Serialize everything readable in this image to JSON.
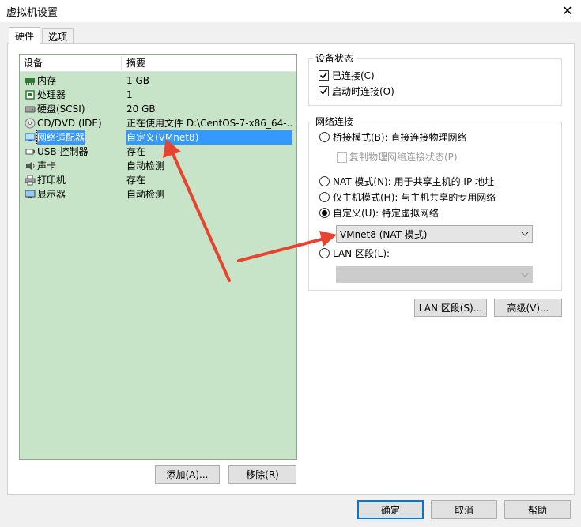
{
  "window": {
    "title": "虚拟机设置",
    "close_glyph": "✕"
  },
  "tabs": [
    {
      "label": "硬件",
      "active": true
    },
    {
      "label": "选项",
      "active": false
    }
  ],
  "hardware_list": {
    "columns": {
      "device": "设备",
      "summary": "摘要"
    },
    "rows": [
      {
        "icon": "memory-icon",
        "name": "内存",
        "summary": "1 GB"
      },
      {
        "icon": "processor-icon",
        "name": "处理器",
        "summary": "1"
      },
      {
        "icon": "harddisk-icon",
        "name": "硬盘(SCSI)",
        "summary": "20 GB"
      },
      {
        "icon": "cd-dvd-icon",
        "name": "CD/DVD (IDE)",
        "summary": "正在使用文件 D:\\CentOS-7-x86_64-..."
      },
      {
        "icon": "network-adapter-icon",
        "name": "网络适配器",
        "summary": "自定义(VMnet8)",
        "selected": true
      },
      {
        "icon": "usb-icon",
        "name": "USB 控制器",
        "summary": "存在"
      },
      {
        "icon": "sound-card-icon",
        "name": "声卡",
        "summary": "自动检测"
      },
      {
        "icon": "printer-icon",
        "name": "打印机",
        "summary": "存在"
      },
      {
        "icon": "display-icon",
        "name": "显示器",
        "summary": "自动检测"
      }
    ],
    "add_button": "添加(A)...",
    "remove_button": "移除(R)"
  },
  "device_status": {
    "title": "设备状态",
    "connected": {
      "label": "已连接(C)",
      "checked": true
    },
    "connect_at_power_on": {
      "label": "启动时连接(O)",
      "checked": true
    }
  },
  "network_connection": {
    "title": "网络连接",
    "bridged": {
      "label": "桥接模式(B): 直接连接物理网络",
      "selected": false
    },
    "replicate_state": {
      "label": "复制物理网络连接状态(P)",
      "checked": false,
      "enabled": false
    },
    "nat": {
      "label": "NAT 模式(N): 用于共享主机的 IP 地址",
      "selected": false
    },
    "host_only": {
      "label": "仅主机模式(H): 与主机共享的专用网络",
      "selected": false
    },
    "custom": {
      "label": "自定义(U): 特定虚拟网络",
      "selected": true
    },
    "custom_select_value": "VMnet8 (NAT 模式)",
    "lan_segment": {
      "label": "LAN 区段(L):",
      "selected": false
    },
    "lan_segment_select_value": ""
  },
  "lan_segments_button": "LAN 区段(S)...",
  "advanced_button": "高级(V)...",
  "footer": {
    "ok": "确定",
    "cancel": "取消",
    "help": "帮助"
  },
  "colors": {
    "list_bg": "#c8e4c8",
    "selection": "#3399ff",
    "annotation_arrow": "#e8432e"
  }
}
